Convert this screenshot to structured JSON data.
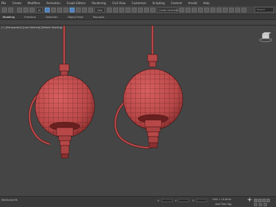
{
  "menubar": {
    "items": [
      "File",
      "Create",
      "Modifiers",
      "Animation",
      "Graph Editors",
      "Rendering",
      "Civil View",
      "Customize",
      "Scripting",
      "Content",
      "Arnold",
      "Help"
    ]
  },
  "toolbar": {
    "selection_filter": "All",
    "view_dropdown": "View",
    "selection_set_placeholder": "Create Selection Set",
    "search_placeholder": "Search"
  },
  "ribbon": {
    "tabs": [
      "Modeling",
      "Freeform",
      "Selection",
      "Object Paint",
      "Populate"
    ]
  },
  "viewport": {
    "label": "[+] [Perspective] [User Defined] [Default Shading]"
  },
  "status": {
    "maxscript_label": "MAXScript Mi.",
    "coord_labels": [
      "X:",
      "Y:",
      "Z:"
    ],
    "grid_text": "Grid = 10,0mm",
    "add_time_tag": "Add Time Tag"
  },
  "colors": {
    "model": "#b84848",
    "model_line": "#3a0d0d",
    "viewport_bg": "#454545",
    "highlight_button": "#4d7fb8"
  }
}
